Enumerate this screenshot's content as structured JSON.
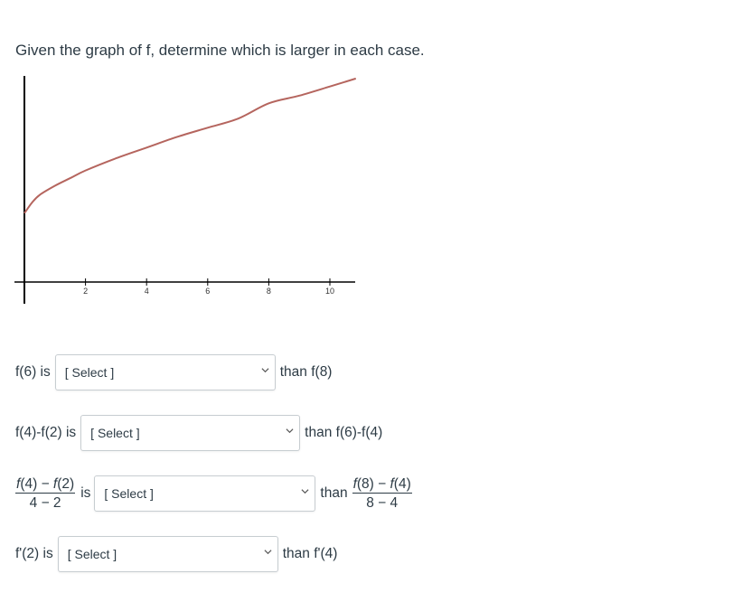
{
  "prompt": "Given the graph of f, determine which is larger in each case.",
  "chart_data": {
    "type": "line",
    "title": "",
    "xlabel": "",
    "ylabel": "",
    "x_ticks": [
      2,
      4,
      6,
      8,
      10
    ],
    "tick_labels": [
      "2",
      "4",
      "6",
      "8",
      "10"
    ],
    "xlim": [
      -0.3,
      10.85
    ],
    "ylim": [
      -0.7,
      6.8
    ],
    "grid": false,
    "line_color": "#b5655e",
    "series": [
      {
        "name": "f",
        "x": [
          0,
          0.25,
          0.5,
          1,
          1.5,
          2,
          3,
          4,
          5,
          6,
          7,
          8,
          9,
          10,
          10.85
        ],
        "y": [
          2.25,
          2.6,
          2.85,
          3.15,
          3.4,
          3.65,
          4.05,
          4.4,
          4.75,
          5.05,
          5.35,
          5.85,
          6.1,
          6.4,
          6.66
        ]
      }
    ]
  },
  "questions": [
    {
      "lead": "f(6) is",
      "select": "[ Select ]",
      "tail": "than f(8)"
    },
    {
      "lead": "f(4)-f(2) is",
      "select": "[ Select ]",
      "tail": "than f(6)-f(4)"
    },
    {
      "lead_num_a": "f",
      "lead_num_b": "(4) − ",
      "lead_num_c": "f",
      "lead_num_d": "(2)",
      "lead_den": "4 − 2",
      "is": "is",
      "select": "[ Select ]",
      "than": "than",
      "tail_num_a": "f",
      "tail_num_b": "(8) − ",
      "tail_num_c": "f",
      "tail_num_d": "(4)",
      "tail_den": "8 − 4"
    },
    {
      "lead": "f'(2) is",
      "select": "[ Select ]",
      "tail": "than f'(4)"
    }
  ],
  "icons": {
    "select_chevron": "chevron-down-icon"
  }
}
